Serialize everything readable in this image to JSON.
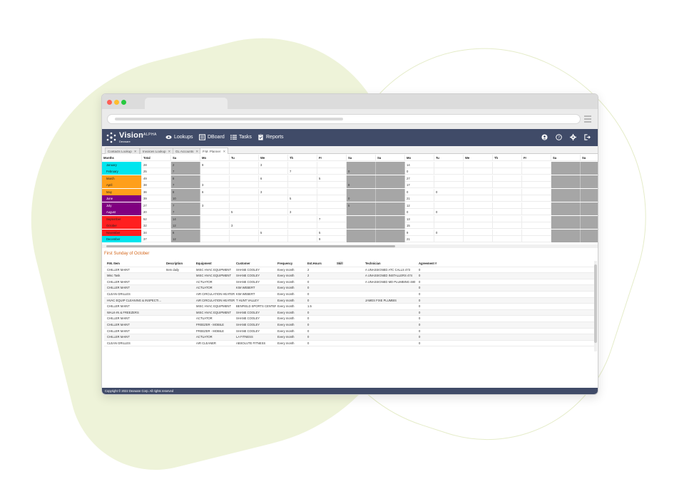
{
  "colors": {
    "nav_bg": "#404b68",
    "accent_orange": "#d4661a",
    "weekend_gray": "#a6a6a6",
    "month_colors": [
      "#00e5ee",
      "#00e5ee",
      "#ff9f1a",
      "#ff9f1a",
      "#ff9f1a",
      "#800080",
      "#800080",
      "#800080",
      "#ff1f1f",
      "#ff1f1f",
      "#ff1f1f",
      "#00e5ee"
    ]
  },
  "browser": {
    "menu_icon": "hamburger-icon"
  },
  "app": {
    "logo_text": "Vision",
    "logo_badge": "ALPHA",
    "logo_sub": "Dexware",
    "nav": [
      {
        "label": "Lookups",
        "icon": "eye-icon"
      },
      {
        "label": "DBoard",
        "icon": "dashboard-icon"
      },
      {
        "label": "Tasks",
        "icon": "list-icon"
      },
      {
        "label": "Reports",
        "icon": "clipboard-icon"
      }
    ],
    "right_icons": [
      "user-icon",
      "help-icon",
      "settings-icon",
      "logout-icon"
    ]
  },
  "tabs": [
    {
      "label": "Contacts Lookup"
    },
    {
      "label": "Invoices Lookup"
    },
    {
      "label": "GL Accounts"
    },
    {
      "label": "P.M. Planner"
    }
  ],
  "calendar": {
    "headers": [
      "Months",
      "Total",
      "Sa",
      "Mo",
      "Tu",
      "We",
      "Th",
      "Fr",
      "Sa",
      "Su",
      "Mo",
      "Tu",
      "We",
      "Th",
      "Fr",
      "Sa",
      "Su"
    ],
    "rows": [
      {
        "month": "January",
        "total": "28",
        "cells": [
          "2",
          "9",
          "",
          "3",
          "",
          "",
          "",
          "",
          "14",
          "",
          "",
          "",
          "",
          "",
          ""
        ]
      },
      {
        "month": "February",
        "total": "25",
        "cells": [
          "7",
          "",
          "",
          "",
          "7",
          "",
          "0",
          "",
          "0",
          "",
          "",
          "",
          "",
          "",
          ""
        ]
      },
      {
        "month": "March",
        "total": "49",
        "cells": [
          "8",
          "",
          "",
          "6",
          "",
          "5",
          "",
          "",
          "27",
          "",
          "",
          "",
          "",
          "",
          ""
        ]
      },
      {
        "month": "April",
        "total": "38",
        "cells": [
          "7",
          "3",
          "",
          "",
          "",
          "",
          "8",
          "",
          "17",
          "",
          "",
          "",
          "",
          "",
          ""
        ]
      },
      {
        "month": "May",
        "total": "36",
        "cells": [
          "8",
          "6",
          "",
          "3",
          "",
          "",
          "",
          "",
          "0",
          "0",
          "",
          "",
          "",
          "",
          ""
        ]
      },
      {
        "month": "June",
        "total": "39",
        "cells": [
          "10",
          "",
          "",
          "",
          "5",
          "",
          "0",
          "",
          "21",
          "",
          "",
          "",
          "",
          "",
          ""
        ]
      },
      {
        "month": "July",
        "total": "27",
        "cells": [
          "7",
          "3",
          "",
          "",
          "",
          "",
          "5",
          "",
          "12",
          "",
          "",
          "",
          "",
          "",
          ""
        ]
      },
      {
        "month": "August",
        "total": "20",
        "cells": [
          "7",
          "",
          "5",
          "",
          "3",
          "",
          "",
          "",
          "0",
          "0",
          "",
          "",
          "",
          "",
          ""
        ]
      },
      {
        "month": "September",
        "total": "52",
        "cells": [
          "14",
          "",
          "",
          "",
          "",
          "7",
          "",
          "",
          "13",
          "",
          "",
          "",
          "",
          "",
          ""
        ]
      },
      {
        "month": "October",
        "total": "32",
        "cells": [
          "12",
          "",
          "3",
          "",
          "",
          "",
          "",
          "",
          "15",
          "",
          "",
          "",
          "",
          "",
          ""
        ]
      },
      {
        "month": "November",
        "total": "34",
        "cells": [
          "8",
          "",
          "",
          "5",
          "",
          "5",
          "",
          "",
          "9",
          "0",
          "",
          "",
          "",
          "",
          ""
        ]
      },
      {
        "month": "December",
        "total": "37",
        "cells": [
          "12",
          "",
          "",
          "",
          "",
          "9",
          "",
          "",
          "21",
          "",
          "",
          "",
          "",
          "",
          ""
        ]
      }
    ]
  },
  "section_title": "First Sunday of October",
  "pm_table": {
    "headers": [
      "P.M. Item",
      "Description",
      "Equipment",
      "Customer",
      "Frequency",
      "Est.Hours",
      "Skill",
      "Technician",
      "Agreement #"
    ],
    "rows": [
      [
        "CHILLER MAINT",
        "Item daily",
        "MISC HVAC EQUIPMENT",
        "SHANE COOLEY",
        "Every month",
        "2",
        "",
        "A UNASSIGNED ATC CALLS 473",
        "0"
      ],
      [
        "Misc Task",
        "",
        "MISC HVAC EQUIPMENT",
        "SHANE COOLEY",
        "Every month",
        "2",
        "",
        "A UNASSIGNED INSTALLERS 474",
        "0"
      ],
      [
        "CHILLER MAINT",
        "",
        "ACTUATOR",
        "SHANE COOLEY",
        "Every month",
        "0",
        "",
        "A UNASSIGNED MD PLUMBING 480",
        "0"
      ],
      [
        "CHILLER MAINT",
        "",
        "ACTUATOR",
        "KIM WEBERT",
        "Every month",
        "0",
        "",
        "",
        "0"
      ],
      [
        "CLEAN GRILLES",
        "",
        "AIR CIRCULATION HEATER",
        "KIM WEBERT",
        "Every month",
        "0",
        "",
        "",
        "0"
      ],
      [
        "HVAC EQUIP CLEANING & INSPECTI...",
        "",
        "AIR CIRCULATION HEATER",
        "T HUNT VALLEY",
        "Every month",
        "0",
        "",
        "JAMES FIXE PLUMBIS",
        "0"
      ],
      [
        "CHILLER MAINT",
        "",
        "MISC HVAC EQUIPMENT",
        "BENFIELD SPORTS CENTER",
        "Every month",
        "1.5",
        "",
        "",
        "0"
      ],
      [
        "WALK-IN & FREEZERS",
        "",
        "MISC HVAC EQUIPMENT",
        "SHANE COOLEY",
        "Every month",
        "0",
        "",
        "",
        "0"
      ],
      [
        "CHILLER MAINT",
        "",
        "ACTUATOR",
        "SHANE COOLEY",
        "Every month",
        "0",
        "",
        "",
        "0"
      ],
      [
        "CHILLER MAINT",
        "",
        "FREEZER - MOBILE",
        "SHANE COOLEY",
        "Every month",
        "0",
        "",
        "",
        "0"
      ],
      [
        "CHILLER MAINT",
        "",
        "FREEZER - MOBILE",
        "SHANE COOLEY",
        "Every month",
        "0",
        "",
        "",
        "0"
      ],
      [
        "CHILLER MAINT",
        "",
        "ACTUATOR",
        "LA FITNESS",
        "Every month",
        "0",
        "",
        "",
        "0"
      ],
      [
        "CLEAN GRILLES",
        "",
        "AIR CLEANER",
        "ABSOLUTE FITNESS",
        "Every month",
        "0",
        "",
        "",
        "0"
      ]
    ]
  },
  "footer": "Copyright © 2022 Dexware Corp. All rights reserved"
}
